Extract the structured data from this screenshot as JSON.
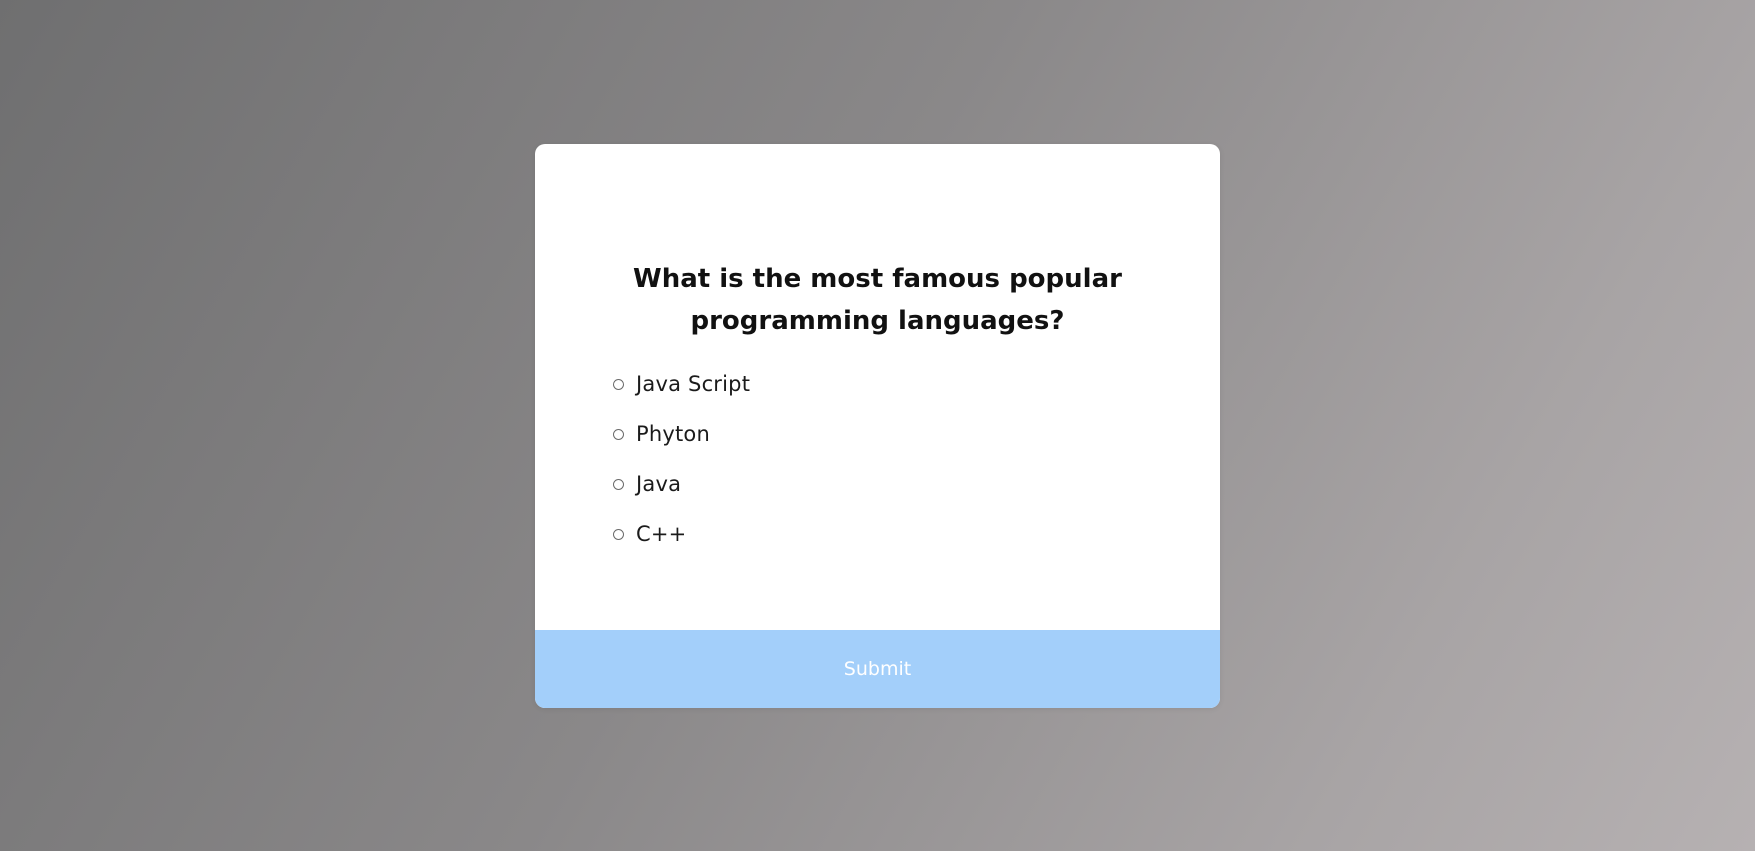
{
  "quiz": {
    "question_line1": "What is the most famous popular",
    "question_line2": "programming languages?",
    "options": [
      {
        "label": "Java Script",
        "selected": false
      },
      {
        "label": "Phyton",
        "selected": false
      },
      {
        "label": "Java",
        "selected": false
      },
      {
        "label": "C++",
        "selected": false
      }
    ],
    "submit_label": "Submit"
  },
  "colors": {
    "submit_bar": "#a3cffa",
    "card": "#ffffff",
    "question_text": "#111111"
  }
}
